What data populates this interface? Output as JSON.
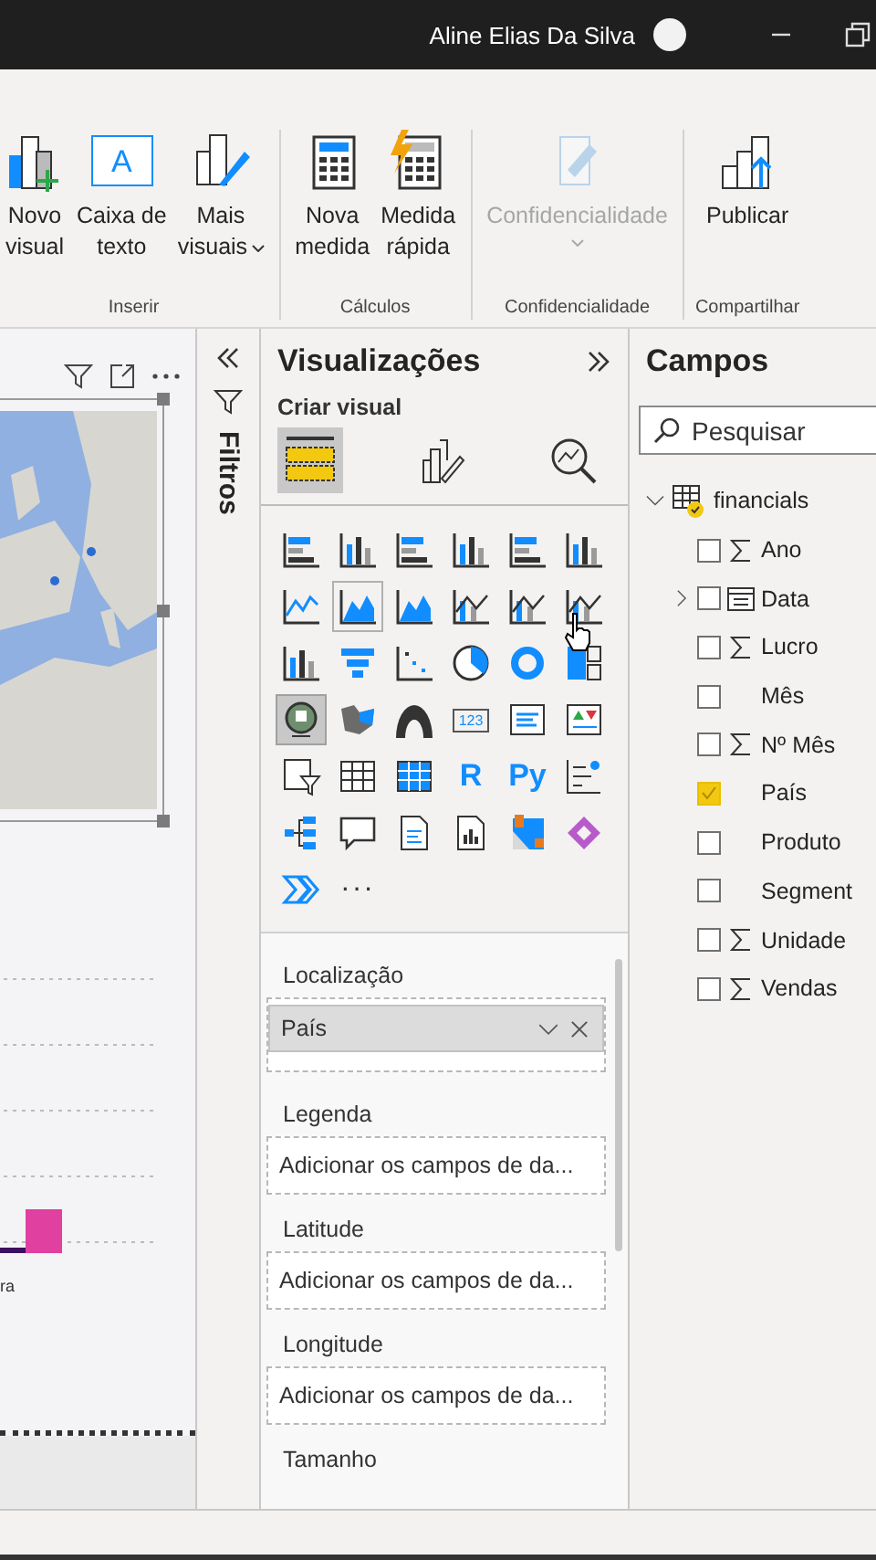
{
  "title_bar": {
    "user_name": "Aline Elias Da Silva"
  },
  "ribbon": {
    "groups": [
      {
        "label": "Inserir",
        "buttons": [
          {
            "lines": [
              "Novo",
              "visual"
            ]
          },
          {
            "lines": [
              "Caixa de",
              "texto"
            ],
            "glyph": "A"
          },
          {
            "lines": [
              "Mais",
              "visuais"
            ],
            "dropdown": true
          }
        ]
      },
      {
        "label": "Cálculos",
        "buttons": [
          {
            "lines": [
              "Nova",
              "medida"
            ]
          },
          {
            "lines": [
              "Medida",
              "rápida"
            ]
          }
        ]
      },
      {
        "label": "Confidencialidade",
        "buttons": [
          {
            "lines": [
              "Confidencialidade"
            ],
            "dropdown": true,
            "disabled": true
          }
        ]
      },
      {
        "label": "Compartilhar",
        "buttons": [
          {
            "lines": [
              "Publicar"
            ]
          }
        ]
      }
    ]
  },
  "canvas": {
    "axis_label": "ra"
  },
  "filters": {
    "label": "Filtros"
  },
  "visualizations": {
    "title": "Visualizações",
    "subtitle": "Criar visual",
    "build_tabs": [
      {
        "selected": true
      },
      {
        "selected": false
      },
      {
        "selected": false
      }
    ],
    "gallery": [
      {
        "kind": "icon",
        "selected": false
      },
      {
        "kind": "icon",
        "selected": false
      },
      {
        "kind": "icon",
        "selected": false
      },
      {
        "kind": "icon",
        "selected": false
      },
      {
        "kind": "icon",
        "selected": false
      },
      {
        "kind": "icon",
        "selected": false
      },
      {
        "kind": "icon",
        "selected": false
      },
      {
        "kind": "icon",
        "selected": false,
        "hovered": true
      },
      {
        "kind": "icon",
        "selected": false
      },
      {
        "kind": "icon",
        "selected": false
      },
      {
        "kind": "icon",
        "selected": false
      },
      {
        "kind": "icon",
        "selected": false
      },
      {
        "kind": "icon",
        "selected": false
      },
      {
        "kind": "icon",
        "selected": false
      },
      {
        "kind": "icon",
        "selected": false
      },
      {
        "kind": "icon",
        "selected": false
      },
      {
        "kind": "icon",
        "selected": false
      },
      {
        "kind": "icon",
        "selected": false
      },
      {
        "kind": "icon",
        "selected": true
      },
      {
        "kind": "icon",
        "selected": false
      },
      {
        "kind": "icon",
        "selected": false
      },
      {
        "kind": "boxed",
        "selected": false,
        "glyph": "123"
      },
      {
        "kind": "icon",
        "selected": false
      },
      {
        "kind": "icon",
        "selected": false
      },
      {
        "kind": "icon",
        "selected": false
      },
      {
        "kind": "icon",
        "selected": false
      },
      {
        "kind": "icon",
        "selected": false
      },
      {
        "kind": "letter",
        "selected": false,
        "glyph": "R"
      },
      {
        "kind": "letter",
        "selected": false,
        "glyph": "Py"
      },
      {
        "kind": "icon",
        "selected": false
      },
      {
        "kind": "icon",
        "selected": false
      },
      {
        "kind": "icon",
        "selected": false
      },
      {
        "kind": "icon",
        "selected": false
      },
      {
        "kind": "icon",
        "selected": false
      },
      {
        "kind": "icon",
        "selected": false
      },
      {
        "kind": "icon",
        "selected": false
      },
      {
        "kind": "icon",
        "selected": false
      }
    ],
    "more": "···",
    "wells": [
      {
        "kind": "filled",
        "label": "Localização",
        "value": "País"
      },
      {
        "kind": "empty",
        "label": "Legenda",
        "placeholder": "Adicionar os campos de da..."
      },
      {
        "kind": "empty",
        "label": "Latitude",
        "placeholder": "Adicionar os campos de da..."
      },
      {
        "kind": "empty",
        "label": "Longitude",
        "placeholder": "Adicionar os campos de da..."
      },
      {
        "kind": "label-only",
        "label": "Tamanho"
      }
    ]
  },
  "fields": {
    "title": "Campos",
    "search": {
      "placeholder": "Pesquisar"
    },
    "tables": [
      {
        "name": "financials",
        "expanded": true,
        "in_use": true,
        "children": [
          {
            "label": "Ano",
            "kind": "sum",
            "checked": false
          },
          {
            "label": "Data",
            "kind": "date",
            "checked": false,
            "expanded": false
          },
          {
            "label": "Lucro",
            "kind": "sum",
            "checked": false
          },
          {
            "label": "Mês",
            "kind": "text",
            "checked": false
          },
          {
            "label": "Nº Mês",
            "kind": "sum",
            "checked": false
          },
          {
            "label": "País",
            "kind": "text",
            "checked": true
          },
          {
            "label": "Produto",
            "kind": "text",
            "checked": false
          },
          {
            "label": "Segment",
            "kind": "text",
            "checked": false
          },
          {
            "label": "Unidade",
            "kind": "sum",
            "checked": false
          },
          {
            "label": "Vendas",
            "kind": "sum",
            "checked": false
          }
        ]
      }
    ]
  }
}
